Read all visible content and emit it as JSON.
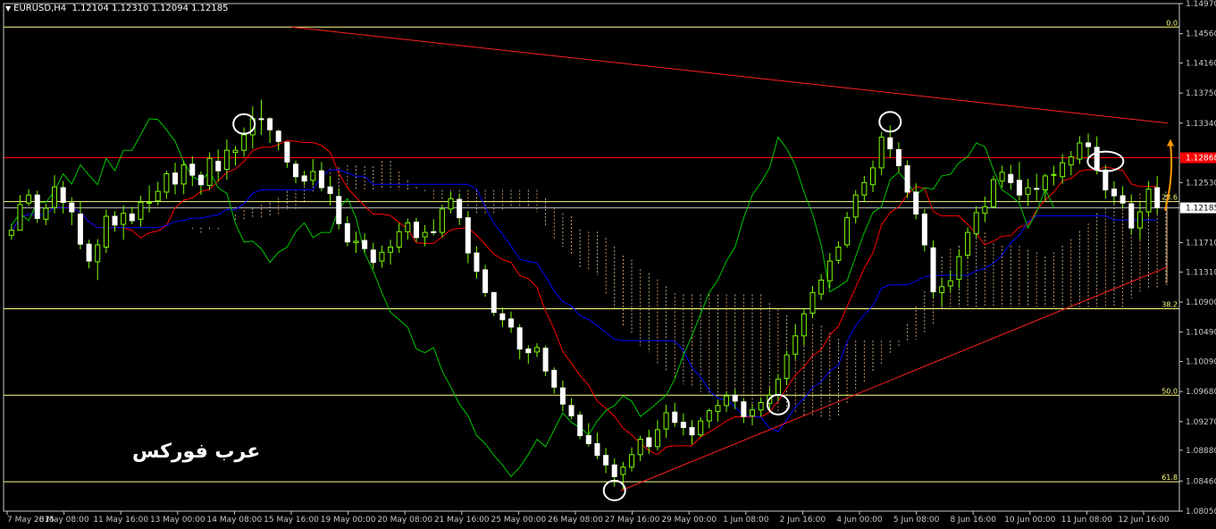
{
  "header": {
    "symbol": "EURUSD,H4",
    "quote": "1.12104 1.12310 1.12094 1.12185"
  },
  "watermark": "عرب فوركس",
  "colors": {
    "background": "#000000",
    "frame": "#c8c8c8",
    "bull": "#7cfc00",
    "bear": "#7cfc00",
    "tenkan": "#ff0000",
    "kijun": "#0000ff",
    "chikou": "#00c800",
    "kumo_a": "#f5deb3",
    "kumo_b": "#ffc080",
    "fib": "#ffff80",
    "trend": "#ff2020",
    "horizontal": "#ff0000",
    "price_line": "#c0c0c0",
    "arrow": "#ff9900",
    "circle": "#ffffff"
  },
  "chart_data": {
    "type": "candlestick",
    "instrument": "EURUSD",
    "timeframe": "H4",
    "ylim": [
      1.0805,
      1.1497
    ],
    "y_ticks": [
      "1.14970",
      "1.14560",
      "1.14160",
      "1.13750",
      "1.13340",
      "1.12530",
      "1.12185",
      "1.11710",
      "1.11310",
      "1.10900",
      "1.10490",
      "1.10090",
      "1.09680",
      "1.09270",
      "1.08880",
      "1.08460",
      "1.08050"
    ],
    "x_ticks": [
      "7 May 2015",
      "8 May 08:00",
      "11 May 16:00",
      "13 May 00:00",
      "14 May 08:00",
      "15 May 16:00",
      "19 May 00:00",
      "20 May 08:00",
      "21 May 16:00",
      "25 May 00:00",
      "26 May 08:00",
      "27 May 16:00",
      "29 May 00:00",
      "1 Jun 08:00",
      "2 Jun 16:00",
      "4 Jun 00:00",
      "5 Jun 08:00",
      "8 Jun 16:00",
      "10 Jun 00:00",
      "11 Jun 08:00",
      "12 Jun 16:00"
    ],
    "current_price": "1.12185",
    "horizontal_level": "1.12868",
    "fib_levels": [
      {
        "label": "0.0",
        "price": 1.1465
      },
      {
        "label": "23.6",
        "price": 1.1227
      },
      {
        "label": "38.2",
        "price": 1.1081
      },
      {
        "label": "50.0",
        "price": 1.0963
      },
      {
        "label": "61.8",
        "price": 1.0845
      }
    ],
    "trendlines": [
      {
        "name": "upper",
        "from": [
          0.245,
          1.1465
        ],
        "to": [
          0.99,
          1.1334
        ]
      },
      {
        "name": "lower",
        "from": [
          0.525,
          1.0833
        ],
        "to": [
          0.99,
          1.1138
        ]
      }
    ],
    "candles": [
      [
        1.1181,
        1.1196,
        1.1175,
        1.1188
      ],
      [
        1.1188,
        1.1236,
        1.1189,
        1.1223
      ],
      [
        1.1225,
        1.1244,
        1.1221,
        1.1236
      ],
      [
        1.1236,
        1.1242,
        1.1198,
        1.1204
      ],
      [
        1.1203,
        1.1224,
        1.1195,
        1.1218
      ],
      [
        1.1219,
        1.1263,
        1.1211,
        1.1247
      ],
      [
        1.1246,
        1.1255,
        1.1211,
        1.1226
      ],
      [
        1.1225,
        1.1233,
        1.1195,
        1.1213
      ],
      [
        1.121,
        1.1228,
        1.1162,
        1.1169
      ],
      [
        1.1169,
        1.1175,
        1.1136,
        1.1146
      ],
      [
        1.1145,
        1.1176,
        1.112,
        1.1168
      ],
      [
        1.1165,
        1.1216,
        1.1157,
        1.1207
      ],
      [
        1.1207,
        1.1214,
        1.1186,
        1.1195
      ],
      [
        1.1196,
        1.1222,
        1.1175,
        1.1211
      ],
      [
        1.121,
        1.122,
        1.1196,
        1.1201
      ],
      [
        1.1203,
        1.1235,
        1.1193,
        1.1226
      ],
      [
        1.1225,
        1.1249,
        1.1212,
        1.1226
      ],
      [
        1.1228,
        1.1254,
        1.1222,
        1.1241
      ],
      [
        1.124,
        1.1269,
        1.1231,
        1.1265
      ],
      [
        1.1266,
        1.128,
        1.1237,
        1.1251
      ],
      [
        1.1251,
        1.1283,
        1.1237,
        1.1277
      ],
      [
        1.1278,
        1.1289,
        1.1248,
        1.1263
      ],
      [
        1.1263,
        1.1268,
        1.1236,
        1.125
      ],
      [
        1.1249,
        1.1294,
        1.1243,
        1.1286
      ],
      [
        1.1282,
        1.1298,
        1.1255,
        1.1269
      ],
      [
        1.1271,
        1.1312,
        1.1257,
        1.1297
      ],
      [
        1.1294,
        1.1303,
        1.1276,
        1.1297
      ],
      [
        1.1297,
        1.1328,
        1.1288,
        1.1318
      ],
      [
        1.1318,
        1.1357,
        1.1299,
        1.134
      ],
      [
        1.134,
        1.1366,
        1.1318,
        1.1339
      ],
      [
        1.134,
        1.1342,
        1.1307,
        1.1325
      ],
      [
        1.1323,
        1.1325,
        1.1297,
        1.1309
      ],
      [
        1.1308,
        1.1309,
        1.1273,
        1.1281
      ],
      [
        1.1278,
        1.1283,
        1.1252,
        1.1261
      ],
      [
        1.1262,
        1.1269,
        1.1249,
        1.1255
      ],
      [
        1.1256,
        1.1285,
        1.1249,
        1.1268
      ],
      [
        1.1269,
        1.1281,
        1.1241,
        1.1246
      ],
      [
        1.1247,
        1.1262,
        1.1222,
        1.1238
      ],
      [
        1.1234,
        1.1245,
        1.1189,
        1.1197
      ],
      [
        1.1197,
        1.1207,
        1.1166,
        1.1172
      ],
      [
        1.1171,
        1.1186,
        1.1157,
        1.1173
      ],
      [
        1.1174,
        1.1184,
        1.1158,
        1.1163
      ],
      [
        1.1161,
        1.1171,
        1.1135,
        1.1144
      ],
      [
        1.1146,
        1.1167,
        1.1137,
        1.1158
      ],
      [
        1.1158,
        1.1175,
        1.1141,
        1.1165
      ],
      [
        1.1165,
        1.1198,
        1.1157,
        1.1186
      ],
      [
        1.1186,
        1.1204,
        1.1175,
        1.1198
      ],
      [
        1.1199,
        1.1205,
        1.1172,
        1.1178
      ],
      [
        1.1179,
        1.1195,
        1.1166,
        1.1185
      ],
      [
        1.1186,
        1.1203,
        1.1181,
        1.1185
      ],
      [
        1.1185,
        1.1223,
        1.1178,
        1.1217
      ],
      [
        1.1217,
        1.124,
        1.1211,
        1.1231
      ],
      [
        1.123,
        1.1238,
        1.1195,
        1.1205
      ],
      [
        1.1205,
        1.1214,
        1.1143,
        1.1157
      ],
      [
        1.1157,
        1.1166,
        1.1122,
        1.1132
      ],
      [
        1.1134,
        1.1141,
        1.1097,
        1.1103
      ],
      [
        1.1103,
        1.1104,
        1.1071,
        1.1076
      ],
      [
        1.1074,
        1.1083,
        1.1056,
        1.1066
      ],
      [
        1.1067,
        1.1077,
        1.1048,
        1.1056
      ],
      [
        1.1055,
        1.106,
        1.1012,
        1.1026
      ],
      [
        1.1026,
        1.1031,
        1.1006,
        1.1021
      ],
      [
        1.1022,
        1.1034,
        1.1015,
        1.1028
      ],
      [
        1.1027,
        1.1031,
        1.0989,
        1.0996
      ],
      [
        1.0997,
        1.1001,
        1.0965,
        1.0974
      ],
      [
        1.0973,
        1.0983,
        1.0941,
        1.0951
      ],
      [
        1.0949,
        1.0959,
        1.093,
        1.0935
      ],
      [
        1.0936,
        1.0941,
        1.0903,
        1.0908
      ],
      [
        1.0908,
        1.0925,
        1.0893,
        1.0897
      ],
      [
        1.0897,
        1.0912,
        1.0876,
        1.0881
      ],
      [
        1.0881,
        1.0891,
        1.0857,
        1.0868
      ],
      [
        1.0868,
        1.0877,
        1.0838,
        1.0852
      ],
      [
        1.0855,
        1.0872,
        1.0835,
        1.0865
      ],
      [
        1.0865,
        1.0892,
        1.0859,
        1.0882
      ],
      [
        1.0882,
        1.0908,
        1.0873,
        1.0903
      ],
      [
        1.0905,
        1.0916,
        1.0883,
        1.0893
      ],
      [
        1.0893,
        1.0929,
        1.0888,
        1.0916
      ],
      [
        1.0917,
        1.095,
        1.0905,
        1.0939
      ],
      [
        1.094,
        1.0953,
        1.092,
        1.0926
      ],
      [
        1.0926,
        1.0938,
        1.0908,
        1.0919
      ],
      [
        1.0919,
        1.0929,
        1.0896,
        1.0909
      ],
      [
        1.0909,
        1.0933,
        1.0906,
        1.0928
      ],
      [
        1.0928,
        1.0945,
        1.0918,
        1.0942
      ],
      [
        1.0941,
        1.0957,
        1.0927,
        1.0949
      ],
      [
        1.0949,
        1.0968,
        1.094,
        1.0962
      ],
      [
        1.0963,
        1.0971,
        1.0944,
        1.0955
      ],
      [
        1.0954,
        1.0959,
        1.0925,
        1.0934
      ],
      [
        1.0935,
        1.0951,
        1.0922,
        1.0943
      ],
      [
        1.0943,
        1.096,
        1.0934,
        1.0953
      ],
      [
        1.0952,
        1.0974,
        1.0941,
        1.0963
      ],
      [
        1.0963,
        1.0992,
        1.0955,
        1.0985
      ],
      [
        1.0986,
        1.1024,
        1.0977,
        1.1018
      ],
      [
        1.1019,
        1.1059,
        1.1011,
        1.1044
      ],
      [
        1.1044,
        1.1082,
        1.1031,
        1.1074
      ],
      [
        1.1075,
        1.1112,
        1.1068,
        1.1103
      ],
      [
        1.1101,
        1.1128,
        1.1093,
        1.112
      ],
      [
        1.1119,
        1.1157,
        1.1109,
        1.1146
      ],
      [
        1.1147,
        1.1173,
        1.1142,
        1.1165
      ],
      [
        1.1168,
        1.1213,
        1.1164,
        1.1205
      ],
      [
        1.1206,
        1.1243,
        1.1197,
        1.1236
      ],
      [
        1.1236,
        1.1262,
        1.1226,
        1.1253
      ],
      [
        1.125,
        1.1283,
        1.124,
        1.1273
      ],
      [
        1.1273,
        1.1322,
        1.1263,
        1.1315
      ],
      [
        1.1314,
        1.1331,
        1.1287,
        1.1299
      ],
      [
        1.1298,
        1.1308,
        1.1267,
        1.1276
      ],
      [
        1.1276,
        1.1283,
        1.1232,
        1.124
      ],
      [
        1.124,
        1.1252,
        1.1203,
        1.121
      ],
      [
        1.121,
        1.1217,
        1.1159,
        1.1168
      ],
      [
        1.1164,
        1.1174,
        1.1096,
        1.1104
      ],
      [
        1.1103,
        1.1123,
        1.1084,
        1.1111
      ],
      [
        1.1112,
        1.1133,
        1.1104,
        1.1119
      ],
      [
        1.1121,
        1.1162,
        1.1109,
        1.1152
      ],
      [
        1.1154,
        1.1192,
        1.1149,
        1.1185
      ],
      [
        1.1183,
        1.1221,
        1.1178,
        1.1212
      ],
      [
        1.1211,
        1.1234,
        1.1199,
        1.122
      ],
      [
        1.122,
        1.1262,
        1.1219,
        1.1257
      ],
      [
        1.1255,
        1.1276,
        1.1246,
        1.1267
      ],
      [
        1.1264,
        1.1277,
        1.1243,
        1.1253
      ],
      [
        1.1256,
        1.1281,
        1.1229,
        1.1236
      ],
      [
        1.1237,
        1.1258,
        1.1221,
        1.1246
      ],
      [
        1.1245,
        1.1265,
        1.1228,
        1.1244
      ],
      [
        1.1243,
        1.1265,
        1.1228,
        1.1262
      ],
      [
        1.1264,
        1.1276,
        1.1249,
        1.1264
      ],
      [
        1.1261,
        1.1292,
        1.1251,
        1.128
      ],
      [
        1.1277,
        1.1296,
        1.1263,
        1.1288
      ],
      [
        1.1285,
        1.1316,
        1.1278,
        1.1307
      ],
      [
        1.1307,
        1.132,
        1.1286,
        1.1302
      ],
      [
        1.1301,
        1.1316,
        1.1264,
        1.127
      ],
      [
        1.127,
        1.1277,
        1.1231,
        1.1243
      ],
      [
        1.1244,
        1.1255,
        1.1224,
        1.1235
      ],
      [
        1.1235,
        1.1248,
        1.1219,
        1.1225
      ],
      [
        1.1224,
        1.1237,
        1.1182,
        1.1191
      ],
      [
        1.1191,
        1.1226,
        1.1175,
        1.1213
      ],
      [
        1.1213,
        1.1255,
        1.1206,
        1.1244
      ],
      [
        1.1246,
        1.1262,
        1.121,
        1.1219
      ]
    ]
  }
}
